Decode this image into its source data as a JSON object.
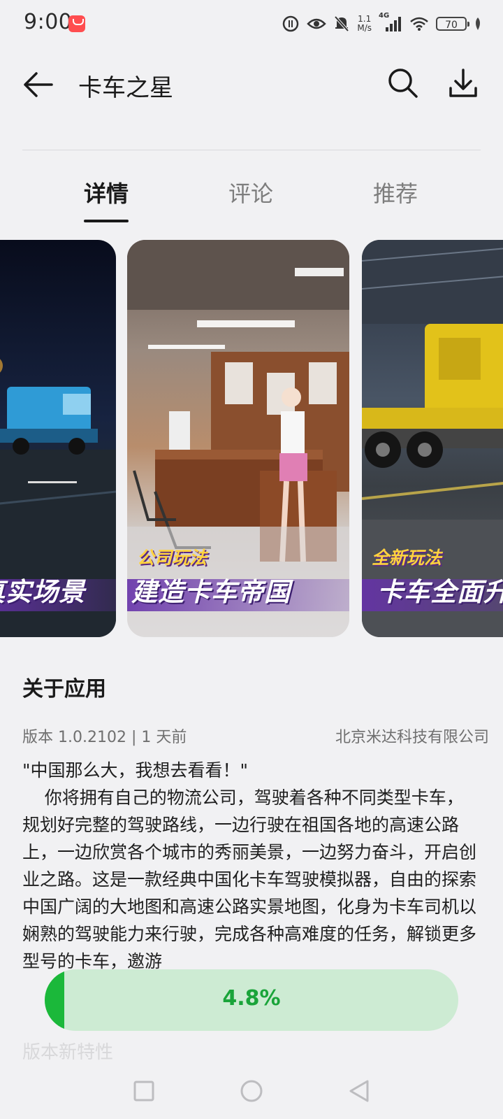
{
  "status_bar": {
    "time": "9:00",
    "net_speed_value": "1.1",
    "net_speed_unit": "M/s",
    "network_type": "4G",
    "battery": "70"
  },
  "header": {
    "title": "卡车之星"
  },
  "tabs": [
    {
      "label": "详情",
      "active": true
    },
    {
      "label": "评论",
      "active": false
    },
    {
      "label": "推荐",
      "active": false
    }
  ],
  "screenshots": [
    {
      "caption_main": "真实场景"
    },
    {
      "caption_sub": "公司玩法",
      "caption_main": "建造卡车帝国"
    },
    {
      "caption_sub": "全新玩法",
      "caption_main": "卡车全面升"
    }
  ],
  "about": {
    "title": "关于应用",
    "version": "版本 1.0.2102 | 1 天前",
    "developer": "北京米达科技有限公司",
    "description": "\"中国那么大，我想去看看！\"\n    你将拥有自己的物流公司，驾驶着各种不同类型卡车，规划好完整的驾驶路线，一边行驶在祖国各地的高速公路上，一边欣赏各个城市的秀丽美景，一边努力奋斗，开启创业之路。这是一款经典中国化卡车驾驶模拟器，自由的探索中国广阔的大地图和高速公路实景地图，化身为卡车司机以娴熟的驾驶能力来行驶，完成各种高难度的任务，解锁更多型号的卡车，邀游",
    "whats_new": "版本新特性"
  },
  "download_progress": {
    "text": "4.8%",
    "fraction": 0.048,
    "fill_color": "#1bb83a",
    "track_color": "#cdebd3"
  }
}
